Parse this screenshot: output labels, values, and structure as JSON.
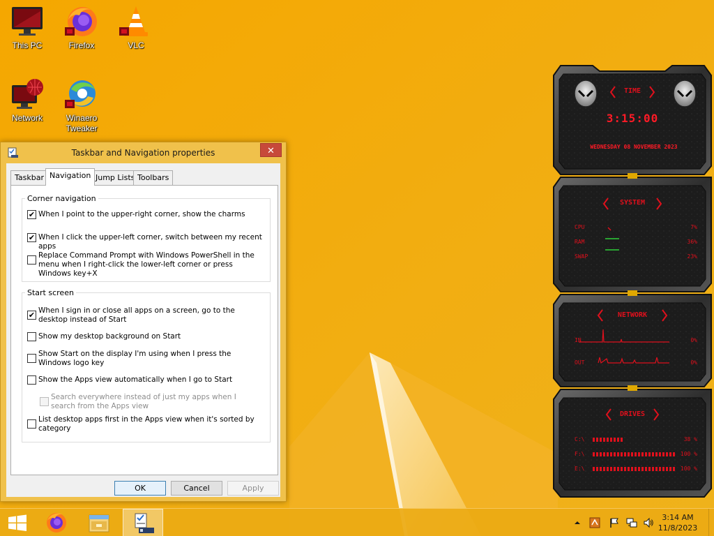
{
  "desktop": {
    "icons": [
      {
        "label": "This PC",
        "icon": "computer-icon"
      },
      {
        "label": "Firefox",
        "icon": "firefox-icon"
      },
      {
        "label": "VLC",
        "icon": "vlc-cone-icon"
      },
      {
        "label": "Network",
        "icon": "network-globe-icon"
      },
      {
        "label": "Winaero Tweaker",
        "icon": "winaero-tweaker-icon"
      }
    ]
  },
  "dialog": {
    "title": "Taskbar and Navigation properties",
    "close_glyph": "✕",
    "tabs": [
      {
        "label": "Taskbar",
        "active": false
      },
      {
        "label": "Navigation",
        "active": true
      },
      {
        "label": "Jump Lists",
        "active": false
      },
      {
        "label": "Toolbars",
        "active": false
      }
    ],
    "corner_navigation": {
      "label": "Corner navigation",
      "options": [
        {
          "text": "When I point to the upper-right corner, show the charms",
          "checked": true
        },
        {
          "text": "When I click the upper-left corner, switch between my recent apps",
          "checked": true
        },
        {
          "text": "Replace Command Prompt with Windows PowerShell in the menu when I right-click the lower-left corner or press Windows key+X",
          "checked": false
        }
      ]
    },
    "start_screen": {
      "label": "Start screen",
      "options": [
        {
          "text": "When I sign in or close all apps on a screen, go to the desktop instead of Start",
          "checked": true
        },
        {
          "text": "Show my desktop background on Start",
          "checked": false
        },
        {
          "text": "Show Start on the display I'm using when I press the Windows logo key",
          "checked": false
        },
        {
          "text": "Show the Apps view automatically when I go to Start",
          "checked": false
        },
        {
          "text": "Search everywhere instead of just my apps when I search from the Apps view",
          "checked": false,
          "disabled": true
        },
        {
          "text": "List desktop apps first in the Apps view when it's sorted by category",
          "checked": false
        }
      ]
    },
    "buttons": {
      "ok": "OK",
      "cancel": "Cancel",
      "apply": "Apply"
    }
  },
  "gadget": {
    "time": {
      "header": "TIME",
      "clock": "3:15:00",
      "date": "WEDNESDAY 08 NOVEMBER 2023"
    },
    "system": {
      "header": "SYSTEM",
      "rows": [
        {
          "label": "CPU",
          "value": "7%"
        },
        {
          "label": "RAM",
          "value": "36%"
        },
        {
          "label": "SWAP",
          "value": "23%"
        }
      ]
    },
    "network": {
      "header": "NETWORK",
      "rows": [
        {
          "label": "IN",
          "value": "0%"
        },
        {
          "label": "OUT",
          "value": "0%"
        }
      ]
    },
    "drives": {
      "header": "DRIVES",
      "rows": [
        {
          "label": "C:\\",
          "value": "38 %",
          "fill": 0.38
        },
        {
          "label": "F:\\",
          "value": "100 %",
          "fill": 1.0
        },
        {
          "label": "E:\\",
          "value": "100 %",
          "fill": 1.0
        }
      ]
    },
    "colors": {
      "accent": "#e0101c",
      "frame": "#3a3a3a"
    }
  },
  "taskbar": {
    "apps": [
      {
        "icon": "windows-start-icon"
      },
      {
        "icon": "firefox-icon"
      },
      {
        "icon": "file-explorer-icon"
      },
      {
        "icon": "taskbar-properties-icon",
        "active": true
      }
    ],
    "clock_time": "3:14 AM",
    "clock_date": "11/8/2023"
  },
  "colors": {
    "wallpaper": "#f0a800",
    "taskbar": "#ecaa14",
    "dialog_frame": "#f0c14b"
  }
}
